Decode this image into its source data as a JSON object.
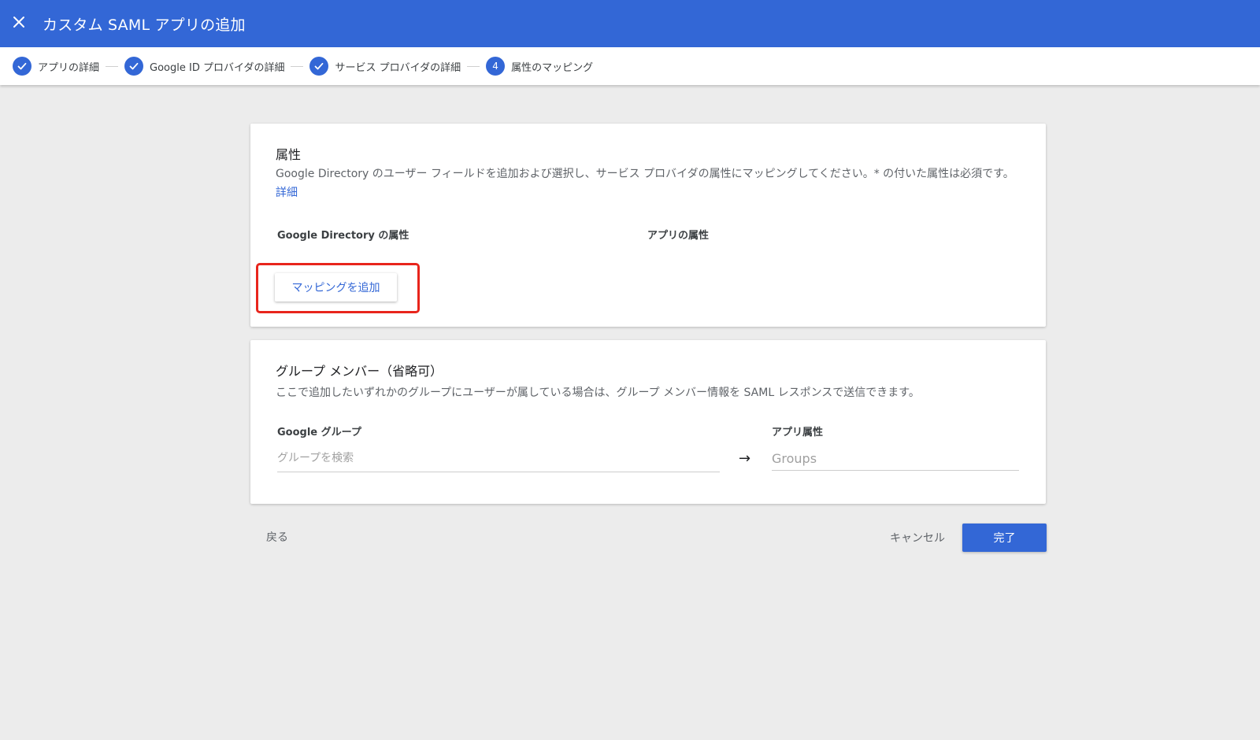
{
  "header": {
    "title": "カスタム SAML アプリの追加",
    "close_icon": "close-icon"
  },
  "stepper": {
    "steps": [
      {
        "label": "アプリの詳細",
        "status": "complete",
        "icon": "check-icon"
      },
      {
        "label": "Google ID プロバイダの詳細",
        "status": "complete",
        "icon": "check-icon"
      },
      {
        "label": "サービス プロバイダの詳細",
        "status": "complete",
        "icon": "check-icon"
      },
      {
        "label": "属性のマッピング",
        "status": "current",
        "number": "4"
      }
    ]
  },
  "attributes_card": {
    "title": "属性",
    "description": "Google Directory のユーザー フィールドを追加および選択し、サービス プロバイダの属性にマッピングしてください。* の付いた属性は必須です。",
    "learn_more": "詳細",
    "col_directory": "Google Directory の属性",
    "col_app": "アプリの属性",
    "add_mapping_label": "マッピングを追加"
  },
  "group_card": {
    "title": "グループ メンバー（省略可）",
    "description": "ここで追加したいずれかのグループにユーザーが属している場合は、グループ メンバー情報を SAML レスポンスで送信できます。",
    "col_google_groups": "Google グループ",
    "col_app_attr": "アプリ属性",
    "search_placeholder": "グループを検索",
    "app_attr_placeholder": "Groups",
    "arrow": "→"
  },
  "footer": {
    "back_label": "戻る",
    "cancel_label": "キャンセル",
    "done_label": "完了"
  },
  "colors": {
    "primary": "#3367d6",
    "highlight": "#e8251c",
    "background": "#ececec"
  }
}
